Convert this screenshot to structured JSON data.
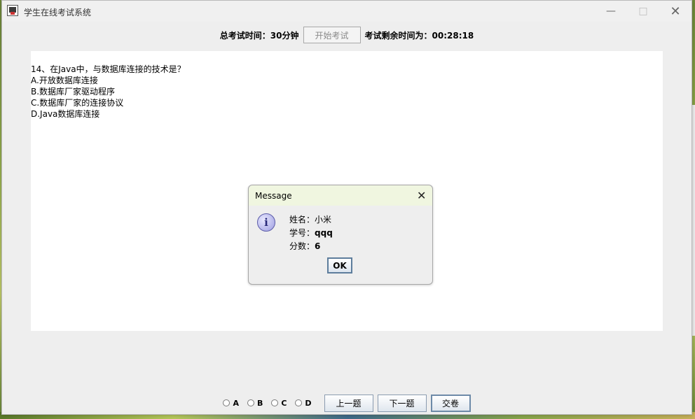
{
  "window": {
    "title": "学生在线考试系统",
    "minimize_icon": "—",
    "maximize_icon": "□",
    "close_icon": "✕"
  },
  "topbar": {
    "total_time_label": "总考试时间：30分钟",
    "start_button": "开始考试",
    "remaining_label": "考试剩余时间为：00:28:18"
  },
  "question": {
    "lines": [
      "14、在Java中，与数据库连接的技术是？",
      "A.开放数据库连接",
      "B.数据库厂家驱动程序",
      "C.数据库厂家的连接协议",
      "D.Java数据库连接"
    ]
  },
  "dialog": {
    "title": "Message",
    "close_icon": "✕",
    "icon_glyph": "i",
    "name_label": "姓名：",
    "name_value": "小米",
    "id_label": "学号：",
    "id_value": "qqq",
    "score_label": "分数：",
    "score_value": "6",
    "ok_button": "OK"
  },
  "bottombar": {
    "options": [
      "A",
      "B",
      "C",
      "D"
    ],
    "prev_button": "上一题",
    "next_button": "下一题",
    "submit_button": "交卷"
  }
}
